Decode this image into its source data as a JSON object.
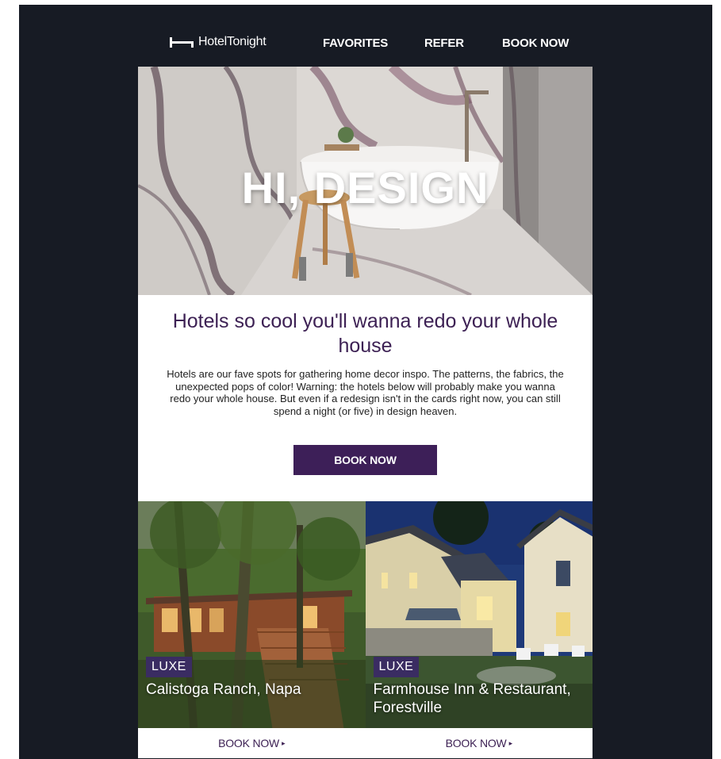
{
  "header": {
    "logo_text": "HotelTonight",
    "nav": [
      "FAVORITES",
      "REFER",
      "BOOK NOW"
    ]
  },
  "hero": {
    "title": "HI, DESIGN"
  },
  "intro": {
    "headline": "Hotels so cool you'll wanna redo your whole house",
    "body": "Hotels are our fave spots for gathering home decor inspo. The patterns, the fabrics, the unexpected pops of color! Warning: the hotels below will probably make you wanna redo your whole house. But even if a redesign isn't in the cards right now, you can still spend a night (or five) in design heaven.",
    "cta_label": "BOOK NOW"
  },
  "hotels": [
    {
      "badge": "LUXE",
      "name": "Calistoga Ranch, Napa",
      "cta_label": "BOOK NOW",
      "arrow": "▸"
    },
    {
      "badge": "LUXE",
      "name": "Farmhouse Inn & Restaurant, Forestville",
      "cta_label": "BOOK NOW",
      "arrow": "▸"
    }
  ],
  "colors": {
    "background": "#171b24",
    "brand_purple": "#3d1f58",
    "badge_purple": "#3a2c62",
    "headline_purple": "#3d2154"
  }
}
